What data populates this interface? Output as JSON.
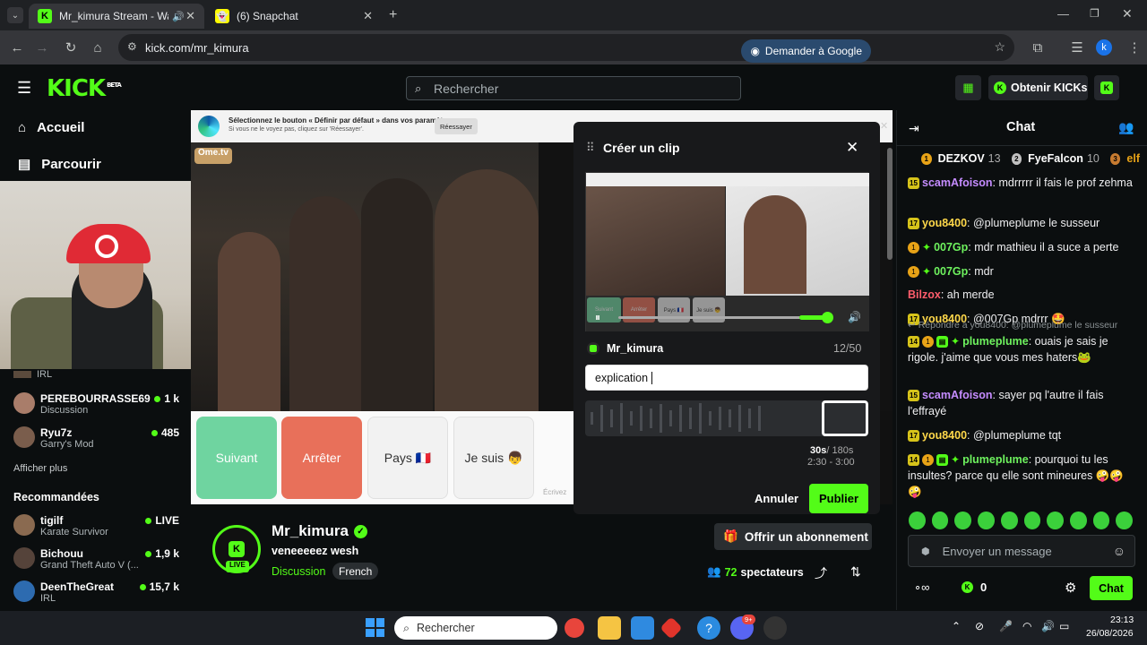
{
  "browser": {
    "tabs": [
      {
        "title": "Mr_kimura Stream - Watch"
      },
      {
        "title": "(6) Snapchat"
      }
    ],
    "url": "kick.com/mr_kimura",
    "ask_google": "Demander à Google",
    "profile_initial": "k"
  },
  "header": {
    "logo": "KICK",
    "logo_badge": "BETA",
    "search_placeholder": "Rechercher",
    "get_kicks": "Obtenir KICKs"
  },
  "sidebar": {
    "nav": [
      {
        "label": "Accueil"
      },
      {
        "label": "Parcourir"
      }
    ],
    "following": [
      {
        "name": "",
        "category": "IRL",
        "viewers": ""
      },
      {
        "name": "PEREBOURRASSE69",
        "category": "Discussion",
        "viewers": "1 k"
      },
      {
        "name": "Ryu7z",
        "category": "Garry's Mod",
        "viewers": "485"
      }
    ],
    "show_more": "Afficher plus",
    "recommended_title": "Recommandées",
    "recommended": [
      {
        "name": "tigilf",
        "category": "Karate Survivor",
        "viewers": "LIVE"
      },
      {
        "name": "Bichouu",
        "category": "Grand Theft Auto V (...",
        "viewers": "1,9 k"
      },
      {
        "name": "DeenTheGreat",
        "category": "IRL",
        "viewers": "15,7 k"
      }
    ]
  },
  "video": {
    "edge_banner_title": "Sélectionnez le bouton « Définir par défaut » dans vos paramètres",
    "edge_banner_sub": "Si vous ne le voyez pas, cliquez sur 'Réessayer'.",
    "edge_retry": "Réessayer",
    "ome_logo": "Ome.tv",
    "buttons": [
      {
        "label": "Suivant",
        "color": "#6fd4a0"
      },
      {
        "label": "Arrêter",
        "color": "#e8705a"
      },
      {
        "label": "Pays 🇫🇷",
        "color": "#f2f2f2"
      },
      {
        "label": "Je suis 👦",
        "color": "#f2f2f2"
      }
    ],
    "type_hint": "Écrivez"
  },
  "clip": {
    "title": "Créer un clip",
    "channel": "Mr_kimura",
    "char_count": "12/50",
    "title_value": "explication ",
    "duration": "30s",
    "duration_max": "/ 180s",
    "range": "2:30 - 3:00",
    "cancel": "Annuler",
    "publish": "Publier",
    "preview_buttons": [
      "Suivant",
      "Arrêter",
      "Pays 🇫🇷",
      "Je suis 👦"
    ],
    "progress": 0.88,
    "volume": 0.5
  },
  "streamer": {
    "name": "Mr_kimura",
    "title": "veneeeeez wesh",
    "category": "Discussion",
    "language": "French",
    "live_badge": "LIVE",
    "subscribe": "Offrir un abonnement",
    "viewers": "72",
    "viewers_label": "spectateurs"
  },
  "chat": {
    "title": "Chat",
    "leaders": [
      {
        "rank": "1",
        "name": "DEZKOV",
        "count": "13"
      },
      {
        "rank": "2",
        "name": "FyeFalcon",
        "count": "10"
      },
      {
        "rank": "3",
        "name": "elf",
        "count": ""
      }
    ],
    "messages": [
      {
        "badges": [
          "15"
        ],
        "user": "scamAfoison",
        "color": "#c58cff",
        "text": "mdrrrrr il fais le prof zehma"
      },
      {
        "badges": [
          "17"
        ],
        "user": "you8400",
        "color": "#ffd84a",
        "text": "@plumeplume le susseur"
      },
      {
        "badges": [
          "1",
          "gem"
        ],
        "user": "007Gp",
        "color": "#6ef25e",
        "text": "mdr mathieu il a suce a perte"
      },
      {
        "badges": [
          "1",
          "gem"
        ],
        "user": "007Gp",
        "color": "#6ef25e",
        "text": "mdr"
      },
      {
        "badges": [],
        "user": "Bilzox",
        "color": "#ff5d6c",
        "text": "ah merde"
      },
      {
        "badges": [
          "17"
        ],
        "user": "you8400",
        "color": "#ffd84a",
        "text": "@007Gp mdrrr 🤩"
      },
      {
        "reply": "Répondre à you8400: @plumeplume le susseur",
        "badges": [
          "14",
          "1",
          "sub",
          "gem"
        ],
        "user": "plumeplume",
        "color": "#6ef25e",
        "text": "ouais je sais je rigole. j'aime que vous mes haters🐸"
      },
      {
        "badges": [
          "15"
        ],
        "user": "scamAfoison",
        "color": "#c58cff",
        "text": "sayer pq l'autre il fais l'effrayé"
      },
      {
        "badges": [
          "17"
        ],
        "user": "you8400",
        "color": "#ffd84a",
        "text": "@plumeplume tqt"
      },
      {
        "badges": [
          "14",
          "1",
          "sub",
          "gem"
        ],
        "user": "plumeplume",
        "color": "#6ef25e",
        "text": "pourquoi tu les insultes? parce qu elle sont mineures 🤪🤪🤪"
      }
    ],
    "input_placeholder": "Envoyer un message",
    "kicks": "0",
    "send": "Chat"
  },
  "taskbar": {
    "search": "Rechercher",
    "time": "23:13",
    "date": "26/08/2026",
    "notif_count": "9+"
  }
}
